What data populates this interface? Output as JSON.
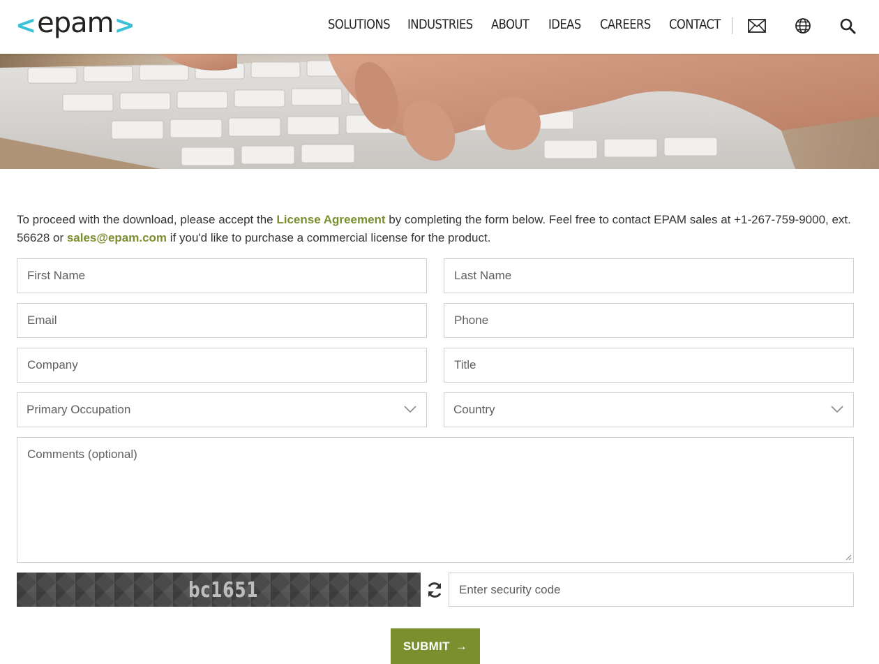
{
  "brand": {
    "logo_text": "epam",
    "accent": "#39c2d7",
    "link_color": "#7b8f2e"
  },
  "nav": {
    "items": [
      {
        "label": "SOLUTIONS"
      },
      {
        "label": "INDUSTRIES"
      },
      {
        "label": "ABOUT"
      },
      {
        "label": "IDEAS"
      },
      {
        "label": "CAREERS"
      },
      {
        "label": "CONTACT"
      }
    ],
    "icons": [
      "mail-icon",
      "globe-icon",
      "search-icon"
    ]
  },
  "hero": {
    "image": "hands-typing-on-keyboard"
  },
  "intro": {
    "text_before_license": "To proceed with the download, please accept the ",
    "license_link": "License Agreement",
    "text_after_license": " by completing the form below. Feel free to contact EPAM sales at +1-267-759-9000, ext. 56628 or ",
    "email_link": "sales@epam.com",
    "text_end": " if you'd like to purchase a commercial license for the product."
  },
  "form": {
    "first_name": "First Name",
    "last_name": "Last Name",
    "email": "Email",
    "phone": "Phone",
    "company": "Company",
    "title": "Title",
    "occupation": "Primary Occupation",
    "country": "Country",
    "comments": "Comments (optional)",
    "captcha_code": "bc1651",
    "security_code_placeholder": "Enter security code",
    "submit_label": "SUBMIT",
    "submit_arrow": "→"
  }
}
